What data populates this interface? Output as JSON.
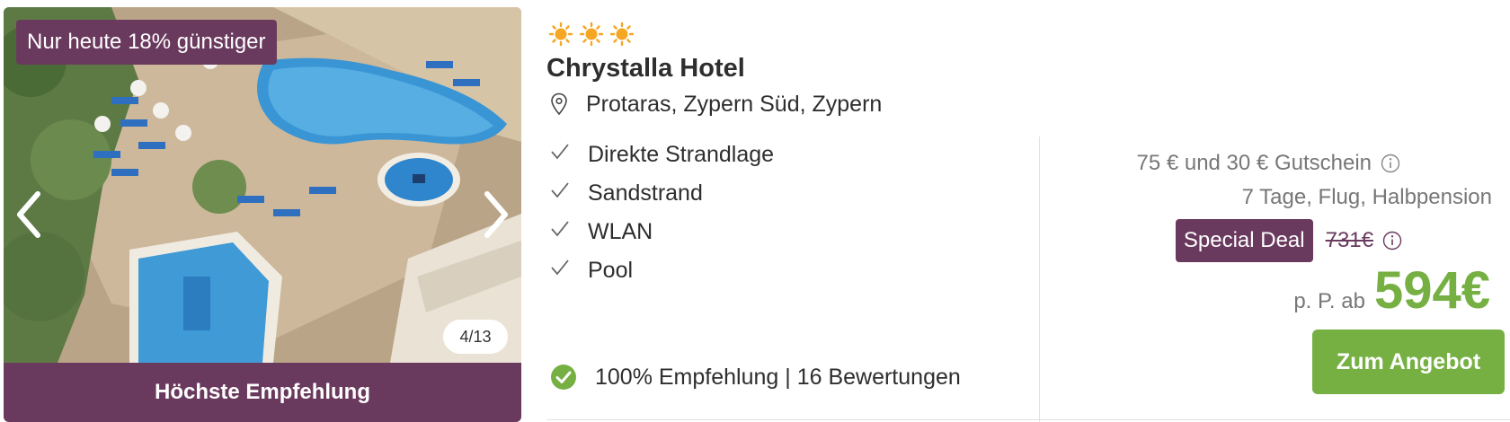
{
  "gallery": {
    "promo_badge": "Nur heute 18% günstiger",
    "counter": "4/13",
    "recommendation_bar": "Höchste Empfehlung",
    "prev_icon": "chevron-left-icon",
    "next_icon": "chevron-right-icon"
  },
  "hotel": {
    "star_count": 3,
    "star_icon": "sun-icon",
    "star_color": "#f5a623",
    "name": "Chrystalla Hotel",
    "location_icon": "map-pin-icon",
    "location": "Protaras, Zypern Süd, Zypern"
  },
  "features": [
    "Direkte Strandlage",
    "Sandstrand",
    "WLAN",
    "Pool"
  ],
  "rating": {
    "icon": "check-circle-icon",
    "text": "100% Empfehlung | 16 Bewertungen"
  },
  "pricing": {
    "voucher_text": "75 € und 30 € Gutschein",
    "trip_details": "7 Tage, Flug, Halbpension",
    "special_deal_label": "Special Deal",
    "old_price": "731€",
    "price_prefix": "p. P. ab",
    "price": "594€",
    "cta_label": "Zum Angebot"
  },
  "colors": {
    "brand_purple": "#6a3a5e",
    "accent_green": "#76b043",
    "muted_text": "#777777"
  }
}
